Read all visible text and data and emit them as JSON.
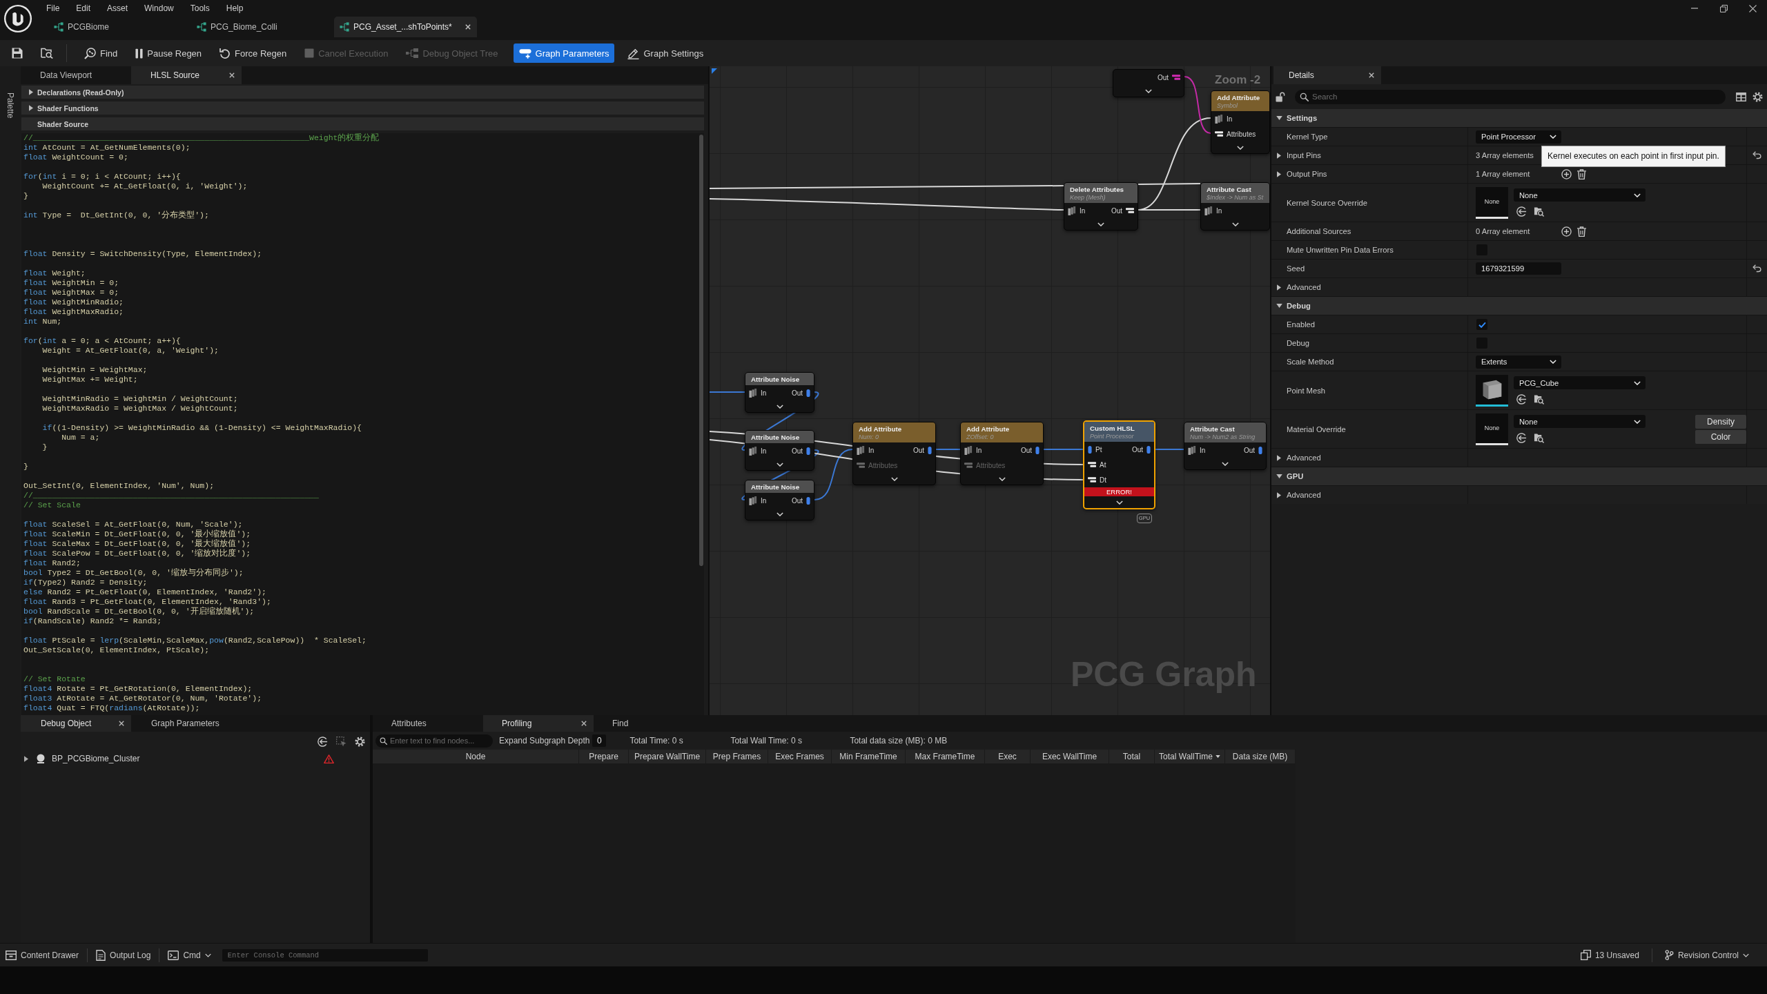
{
  "title_bar": {
    "menu": [
      "File",
      "Edit",
      "Asset",
      "Window",
      "Tools",
      "Help"
    ],
    "tabs": [
      {
        "label": "PCGBiome",
        "selected": false
      },
      {
        "label": "PCG_Biome_Colli",
        "selected": false
      },
      {
        "label": "PCG_Asset_...shToPoints*",
        "selected": true
      }
    ]
  },
  "toolbar": {
    "buttons": [
      {
        "kind": "save",
        "disabled": false,
        "on": false
      },
      {
        "kind": "browse",
        "disabled": false,
        "on": false
      },
      {
        "kind": "find",
        "label": "Find",
        "disabled": false,
        "on": false
      },
      {
        "kind": "pause",
        "label": "Pause Regen",
        "disabled": false,
        "on": false
      },
      {
        "kind": "refresh",
        "label": "Force Regen",
        "disabled": false,
        "on": false
      },
      {
        "kind": "stop",
        "label": "Cancel Execution",
        "disabled": true,
        "on": false
      },
      {
        "kind": "tree",
        "label": "Debug Object Tree",
        "disabled": true,
        "on": false
      },
      {
        "kind": "parameters",
        "label": "Graph Parameters",
        "disabled": false,
        "on": true
      },
      {
        "kind": "settings",
        "label": "Graph Settings",
        "disabled": false,
        "on": false
      }
    ]
  },
  "side_strip": {
    "label": "Palette"
  },
  "hlsl_panel": {
    "tabs": [
      {
        "label": "Data Viewport",
        "selected": false
      },
      {
        "label": "HLSL Source",
        "selected": true
      }
    ],
    "sections": [
      {
        "label": "Declarations (Read-Only)",
        "expanded": false
      },
      {
        "label": "Shader Functions",
        "expanded": false
      },
      {
        "label": "Shader Source",
        "expanded": true
      }
    ],
    "code_lines": [
      {
        "kind": "code",
        "tokens": [
          {
            "kind": "comment",
            "text": "//__________________________________________________________Weight的权重分配"
          }
        ]
      },
      {
        "kind": "code",
        "tokens": [
          {
            "kind": "keyword",
            "text": "int"
          },
          {
            "kind": "plain",
            "text": " AtCount = At_GetNumElements(0);"
          }
        ]
      },
      {
        "kind": "code",
        "tokens": [
          {
            "kind": "keyword",
            "text": "float"
          },
          {
            "kind": "plain",
            "text": " WeightCount = 0;"
          }
        ]
      },
      {
        "kind": "blank"
      },
      {
        "kind": "code",
        "tokens": [
          {
            "kind": "keyword",
            "text": "for"
          },
          {
            "kind": "plain",
            "text": "("
          },
          {
            "kind": "keyword",
            "text": "int"
          },
          {
            "kind": "plain",
            "text": " i = 0; i < AtCount; i++){"
          }
        ]
      },
      {
        "kind": "code",
        "tokens": [
          {
            "kind": "plain",
            "text": "    WeightCount += At_GetFloat(0, i, 'Weight');"
          }
        ]
      },
      {
        "kind": "code",
        "tokens": [
          {
            "kind": "plain",
            "text": "}"
          }
        ]
      },
      {
        "kind": "blank"
      },
      {
        "kind": "code",
        "tokens": [
          {
            "kind": "keyword",
            "text": "int"
          },
          {
            "kind": "plain",
            "text": " Type =  Dt_GetInt(0, 0, '分布类型');"
          }
        ]
      },
      {
        "kind": "blank"
      },
      {
        "kind": "blank"
      },
      {
        "kind": "blank"
      },
      {
        "kind": "code",
        "tokens": [
          {
            "kind": "keyword",
            "text": "float"
          },
          {
            "kind": "plain",
            "text": " Density = SwitchDensity(Type, ElementIndex);"
          }
        ]
      },
      {
        "kind": "blank"
      },
      {
        "kind": "code",
        "tokens": [
          {
            "kind": "keyword",
            "text": "float"
          },
          {
            "kind": "plain",
            "text": " Weight;"
          }
        ]
      },
      {
        "kind": "code",
        "tokens": [
          {
            "kind": "keyword",
            "text": "float"
          },
          {
            "kind": "plain",
            "text": " WeightMin = 0;"
          }
        ]
      },
      {
        "kind": "code",
        "tokens": [
          {
            "kind": "keyword",
            "text": "float"
          },
          {
            "kind": "plain",
            "text": " WeightMax = 0;"
          }
        ]
      },
      {
        "kind": "code",
        "tokens": [
          {
            "kind": "keyword",
            "text": "float"
          },
          {
            "kind": "plain",
            "text": " WeightMinRadio;"
          }
        ]
      },
      {
        "kind": "code",
        "tokens": [
          {
            "kind": "keyword",
            "text": "float"
          },
          {
            "kind": "plain",
            "text": " WeightMaxRadio;"
          }
        ]
      },
      {
        "kind": "code",
        "tokens": [
          {
            "kind": "keyword",
            "text": "int"
          },
          {
            "kind": "plain",
            "text": " Num;"
          }
        ]
      },
      {
        "kind": "blank"
      },
      {
        "kind": "code",
        "tokens": [
          {
            "kind": "keyword",
            "text": "for"
          },
          {
            "kind": "plain",
            "text": "("
          },
          {
            "kind": "keyword",
            "text": "int"
          },
          {
            "kind": "plain",
            "text": " a = 0; a < AtCount; a++){"
          }
        ]
      },
      {
        "kind": "code",
        "tokens": [
          {
            "kind": "plain",
            "text": "    Weight = At_GetFloat(0, a, 'Weight');"
          }
        ]
      },
      {
        "kind": "blank"
      },
      {
        "kind": "code",
        "tokens": [
          {
            "kind": "plain",
            "text": "    WeightMin = WeightMax;"
          }
        ]
      },
      {
        "kind": "code",
        "tokens": [
          {
            "kind": "plain",
            "text": "    WeightMax += Weight;"
          }
        ]
      },
      {
        "kind": "blank"
      },
      {
        "kind": "code",
        "tokens": [
          {
            "kind": "plain",
            "text": "    WeightMinRadio = WeightMin / WeightCount;"
          }
        ]
      },
      {
        "kind": "code",
        "tokens": [
          {
            "kind": "plain",
            "text": "    WeightMaxRadio = WeightMax / WeightCount;"
          }
        ]
      },
      {
        "kind": "blank"
      },
      {
        "kind": "code",
        "tokens": [
          {
            "kind": "keyword",
            "text": "    if"
          },
          {
            "kind": "plain",
            "text": "((1-Density) >= WeightMinRadio && (1-Density) <= WeightMaxRadio){"
          }
        ]
      },
      {
        "kind": "code",
        "tokens": [
          {
            "kind": "plain",
            "text": "        Num = a;"
          }
        ]
      },
      {
        "kind": "code",
        "tokens": [
          {
            "kind": "plain",
            "text": "    }"
          }
        ]
      },
      {
        "kind": "blank"
      },
      {
        "kind": "code",
        "tokens": [
          {
            "kind": "plain",
            "text": "}"
          }
        ]
      },
      {
        "kind": "blank"
      },
      {
        "kind": "code",
        "tokens": [
          {
            "kind": "plain",
            "text": "Out_SetInt(0, ElementIndex, 'Num', Num);"
          }
        ]
      },
      {
        "kind": "code",
        "tokens": [
          {
            "kind": "comment",
            "text": "//____________________________________________________________"
          }
        ]
      },
      {
        "kind": "code",
        "tokens": [
          {
            "kind": "comment",
            "text": "// Set Scale"
          }
        ]
      },
      {
        "kind": "blank"
      },
      {
        "kind": "code",
        "tokens": [
          {
            "kind": "keyword",
            "text": "float"
          },
          {
            "kind": "plain",
            "text": " ScaleSel = At_GetFloat(0, Num, 'Scale');"
          }
        ]
      },
      {
        "kind": "code",
        "tokens": [
          {
            "kind": "keyword",
            "text": "float"
          },
          {
            "kind": "plain",
            "text": " ScaleMin = Dt_GetFloat(0, 0, '最小缩放值');"
          }
        ]
      },
      {
        "kind": "code",
        "tokens": [
          {
            "kind": "keyword",
            "text": "float"
          },
          {
            "kind": "plain",
            "text": " ScaleMax = Dt_GetFloat(0, 0, '最大缩放值');"
          }
        ]
      },
      {
        "kind": "code",
        "tokens": [
          {
            "kind": "keyword",
            "text": "float"
          },
          {
            "kind": "plain",
            "text": " ScalePow = Dt_GetFloat(0, 0, '缩放对比度');"
          }
        ]
      },
      {
        "kind": "code",
        "tokens": [
          {
            "kind": "keyword",
            "text": "float"
          },
          {
            "kind": "plain",
            "text": " Rand2;"
          }
        ]
      },
      {
        "kind": "code",
        "tokens": [
          {
            "kind": "keyword",
            "text": "bool"
          },
          {
            "kind": "plain",
            "text": " Type2 = Dt_GetBool(0, 0, '缩放与分布同步');"
          }
        ]
      },
      {
        "kind": "code",
        "tokens": [
          {
            "kind": "keyword",
            "text": "if"
          },
          {
            "kind": "plain",
            "text": "(Type2) Rand2 = Density;"
          }
        ]
      },
      {
        "kind": "code",
        "tokens": [
          {
            "kind": "keyword",
            "text": "else"
          },
          {
            "kind": "plain",
            "text": " Rand2 = Pt_GetFloat(0, ElementIndex, 'Rand2');"
          }
        ]
      },
      {
        "kind": "code",
        "tokens": [
          {
            "kind": "keyword",
            "text": "float"
          },
          {
            "kind": "plain",
            "text": " Rand3 = Pt_GetFloat(0, ElementIndex, 'Rand3');"
          }
        ]
      },
      {
        "kind": "code",
        "tokens": [
          {
            "kind": "keyword",
            "text": "bool"
          },
          {
            "kind": "plain",
            "text": " RandScale = Dt_GetBool(0, 0, '开启缩放随机');"
          }
        ]
      },
      {
        "kind": "code",
        "tokens": [
          {
            "kind": "keyword",
            "text": "if"
          },
          {
            "kind": "plain",
            "text": "(RandScale) Rand2 *= Rand3;"
          }
        ]
      },
      {
        "kind": "blank"
      },
      {
        "kind": "code",
        "tokens": [
          {
            "kind": "keyword",
            "text": "float"
          },
          {
            "kind": "plain",
            "text": " PtScale = "
          },
          {
            "kind": "keyword",
            "text": "lerp"
          },
          {
            "kind": "plain",
            "text": "(ScaleMin,ScaleMax,"
          },
          {
            "kind": "keyword",
            "text": "pow"
          },
          {
            "kind": "plain",
            "text": "(Rand2,ScalePow))  * ScaleSel;"
          }
        ]
      },
      {
        "kind": "code",
        "tokens": [
          {
            "kind": "plain",
            "text": "Out_SetScale(0, ElementIndex, PtScale);"
          }
        ]
      },
      {
        "kind": "blank"
      },
      {
        "kind": "blank"
      },
      {
        "kind": "code",
        "tokens": [
          {
            "kind": "comment",
            "text": "// Set Rotate"
          }
        ]
      },
      {
        "kind": "code",
        "tokens": [
          {
            "kind": "keyword",
            "text": "float4"
          },
          {
            "kind": "plain",
            "text": " Rotate = Pt_GetRotation(0, ElementIndex);"
          }
        ]
      },
      {
        "kind": "code",
        "tokens": [
          {
            "kind": "keyword",
            "text": "float3"
          },
          {
            "kind": "plain",
            "text": " AtRotate = At_GetRotator(0, Num, 'Rotate');"
          }
        ]
      },
      {
        "kind": "code",
        "tokens": [
          {
            "kind": "keyword",
            "text": "float4"
          },
          {
            "kind": "plain",
            "text": " Quat = FTQ("
          },
          {
            "kind": "keyword",
            "text": "radians"
          },
          {
            "kind": "plain",
            "text": "(AtRotate));"
          }
        ]
      }
    ]
  },
  "graph": {
    "zoom_label": "Zoom -2",
    "graph_type_label": "PCG Graph",
    "nodes": [
      {
        "selected": false,
        "outputs": [
          {
            "label": "Out",
            "kind": "params",
            "connected": true
          }
        ]
      },
      {
        "title": "Add Attribute",
        "subtitle": "Symbol",
        "color": "#7a5e2c",
        "selected": false,
        "inputs": [
          {
            "label": "In",
            "kind": "data",
            "connected": true
          },
          {
            "label": "Attributes",
            "kind": "attributes",
            "connected": true
          }
        ]
      },
      {
        "title": "Delete Attributes",
        "subtitle": "Keep (Mesh)",
        "color": "#4f4f4f",
        "selected": false,
        "inputs": [
          {
            "label": "In",
            "kind": "data",
            "connected": true
          }
        ],
        "outputs": [
          {
            "label": "Out",
            "kind": "attributes",
            "connected": true
          }
        ]
      },
      {
        "title": "Attribute Cast",
        "subtitle": "$Index -> Num as St",
        "color": "#4f4f4f",
        "selected": false,
        "inputs": [
          {
            "label": "In",
            "kind": "data",
            "connected": true
          }
        ]
      },
      {
        "title": "Attribute Noise",
        "color": "#4f4f4f",
        "selected": false,
        "inputs": [
          {
            "label": "In",
            "kind": "data",
            "connected": true
          }
        ],
        "outputs": [
          {
            "label": "Out",
            "kind": "points",
            "connected": true
          }
        ]
      },
      {
        "title": "Attribute Noise",
        "color": "#4f4f4f",
        "selected": false,
        "inputs": [
          {
            "label": "In",
            "kind": "data",
            "connected": true
          }
        ],
        "outputs": [
          {
            "label": "Out",
            "kind": "points",
            "connected": true
          }
        ]
      },
      {
        "title": "Attribute Noise",
        "color": "#4f4f4f",
        "selected": false,
        "inputs": [
          {
            "label": "In",
            "kind": "data",
            "connected": true
          }
        ],
        "outputs": [
          {
            "label": "Out",
            "kind": "points",
            "connected": true
          }
        ]
      },
      {
        "title": "Add Attribute",
        "subtitle": "Num: 0",
        "color": "#7a5e2c",
        "selected": false,
        "inputs": [
          {
            "label": "In",
            "kind": "data",
            "connected": true
          },
          {
            "label": "Attributes",
            "kind": "attributes",
            "connected": false
          }
        ],
        "outputs": [
          {
            "label": "Out",
            "kind": "points",
            "connected": true
          }
        ]
      },
      {
        "title": "Add Attribute",
        "subtitle": "ZOffset: 0",
        "color": "#7a5e2c",
        "selected": false,
        "inputs": [
          {
            "label": "In",
            "kind": "data",
            "connected": true
          },
          {
            "label": "Attributes",
            "kind": "attributes",
            "connected": false
          }
        ],
        "outputs": [
          {
            "label": "Out",
            "kind": "points",
            "connected": true
          }
        ]
      },
      {
        "title": "Custom HLSL",
        "subtitle": "Point Processor",
        "color": "#465566",
        "selected": true,
        "error": "ERROR!",
        "tag": "GPU",
        "inputs": [
          {
            "label": "Pt",
            "kind": "points",
            "connected": true
          },
          {
            "label": "At",
            "kind": "attributes",
            "connected": true
          },
          {
            "label": "Dt",
            "kind": "attributes",
            "connected": true
          }
        ],
        "outputs": [
          {
            "label": "Out",
            "kind": "points",
            "connected": true
          }
        ]
      },
      {
        "title": "Attribute Cast",
        "subtitle": "Num -> Num2 as String",
        "color": "#4f4f4f",
        "selected": false,
        "inputs": [
          {
            "label": "In",
            "kind": "data",
            "connected": true
          }
        ],
        "outputs": [
          {
            "label": "Out",
            "kind": "points",
            "connected": true
          }
        ]
      }
    ]
  },
  "details_panel": {
    "tab": {
      "label": "Details"
    },
    "search": {
      "placeholder": "Search"
    },
    "sections": [
      {
        "title": "Settings",
        "expanded": true,
        "rows": [
          {
            "kind": "dropdown",
            "label": "Kernel Type",
            "value": "Point Processor",
            "resettable": false
          },
          {
            "kind": "array",
            "label": "Input Pins",
            "value": "3 Array elements",
            "expanded": false,
            "edit_buttons": false,
            "resettable": true
          },
          {
            "kind": "array",
            "label": "Output Pins",
            "value": "1 Array element",
            "expanded": false,
            "edit_buttons": true,
            "resettable": false
          },
          {
            "kind": "asset",
            "label": "Kernel Source Override",
            "thumbnail": {
              "kind": "empty",
              "label": "None"
            },
            "value": "None",
            "resettable": false
          },
          {
            "kind": "array",
            "label": "Additional Sources",
            "value": "0 Array element",
            "edit_buttons": true,
            "resettable": false
          },
          {
            "kind": "checkbox",
            "label": "Mute Unwritten Pin Data Errors",
            "checked": false,
            "resettable": false
          },
          {
            "kind": "number",
            "label": "Seed",
            "value": "1679321599",
            "resettable": true
          },
          {
            "kind": "group",
            "label": "Advanced",
            "expanded": false,
            "resettable": false
          }
        ]
      },
      {
        "title": "Debug",
        "expanded": true,
        "rows": [
          {
            "kind": "checkbox",
            "label": "Enabled",
            "checked": true,
            "resettable": false
          },
          {
            "kind": "checkbox",
            "label": "Debug",
            "checked": false,
            "resettable": false
          },
          {
            "kind": "dropdown",
            "label": "Scale Method",
            "value": "Extents",
            "resettable": false
          },
          {
            "kind": "asset",
            "label": "Point Mesh",
            "thumbnail": {
              "kind": "mesh"
            },
            "value": "PCG_Cube",
            "resettable": false
          },
          {
            "kind": "asset",
            "label": "Material Override",
            "thumbnail": {
              "kind": "empty",
              "label": "None"
            },
            "value": "None",
            "buttons": [
              "Density",
              "Color"
            ],
            "resettable": false
          },
          {
            "kind": "group",
            "label": "Advanced",
            "expanded": false,
            "resettable": false
          }
        ]
      },
      {
        "title": "GPU",
        "expanded": true,
        "rows": [
          {
            "kind": "group",
            "label": "Advanced",
            "expanded": false,
            "resettable": false
          }
        ]
      }
    ],
    "tooltip": {
      "text": "Kernel executes on each point in first input pin."
    }
  },
  "debug_panel": {
    "tabs": [
      {
        "label": "Debug Object",
        "selected": true
      },
      {
        "label": "Graph Parameters",
        "selected": false
      }
    ],
    "tree": [
      {
        "label": "BP_PCGBiome_Cluster",
        "expanded": false,
        "warning": true
      }
    ]
  },
  "profiling_panel": {
    "tabs": [
      {
        "label": "Attributes",
        "selected": false
      },
      {
        "label": "Profiling",
        "selected": true
      },
      {
        "label": "Find",
        "selected": false
      }
    ],
    "filter": {
      "placeholder": "Enter text to find nodes..."
    },
    "depth": {
      "label": "Expand Subgraph Depth",
      "value": "0"
    },
    "totals": [
      "Total Time: 0 s",
      "Total Wall Time: 0 s",
      "Total data size (MB): 0 MB"
    ],
    "columns": [
      {
        "label": "Node",
        "sorted": false
      },
      {
        "label": "Prepare",
        "sorted": false
      },
      {
        "label": "Prepare WallTime",
        "sorted": false
      },
      {
        "label": "Prep Frames",
        "sorted": false
      },
      {
        "label": "Exec Frames",
        "sorted": false
      },
      {
        "label": "Min FrameTime",
        "sorted": false
      },
      {
        "label": "Max FrameTime",
        "sorted": false
      },
      {
        "label": "Exec",
        "sorted": false
      },
      {
        "label": "Exec WallTime",
        "sorted": false
      },
      {
        "label": "Total",
        "sorted": false
      },
      {
        "label": "Total WallTime",
        "sorted": true
      },
      {
        "label": "Data size (MB)",
        "sorted": false
      }
    ]
  },
  "status_bar": {
    "left": [
      {
        "kind": "drawer",
        "label": "Content Drawer"
      },
      {
        "kind": "log",
        "label": "Output Log"
      },
      {
        "kind": "cmd",
        "label": "Cmd"
      }
    ],
    "console": {
      "placeholder": "Enter Console Command"
    },
    "right": [
      {
        "kind": "unsaved",
        "label": "13 Unsaved"
      },
      {
        "kind": "revision",
        "label": "Revision Control"
      }
    ]
  }
}
